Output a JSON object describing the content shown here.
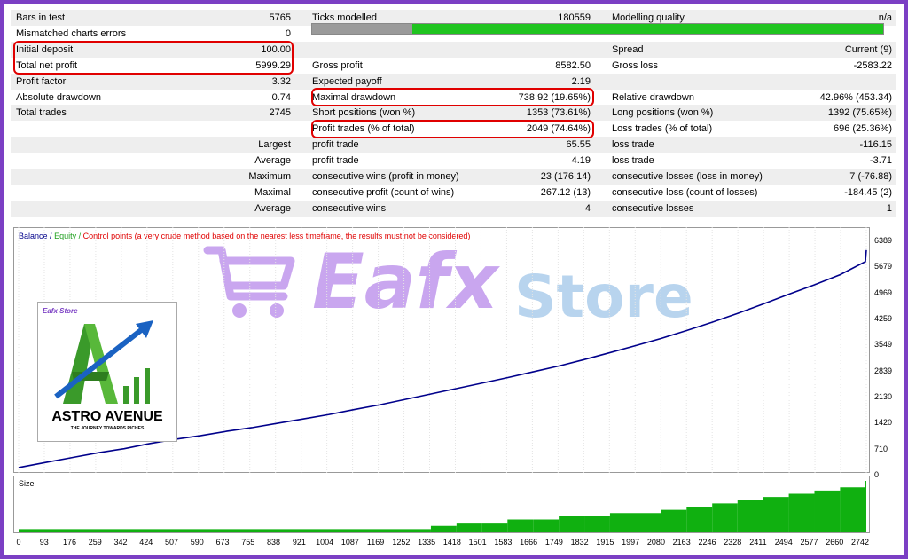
{
  "stats": {
    "rows": [
      {
        "c1l": "Bars in test",
        "c1v": "5765",
        "c2l": "Ticks modelled",
        "c2v": "180559",
        "c3l": "Modelling quality",
        "c3v": "n/a"
      },
      {
        "c1l": "Mismatched charts errors",
        "c1v": "0",
        "c2l": "",
        "c2v": "",
        "c3l": "",
        "c3v": ""
      },
      {
        "c1l": "Initial deposit",
        "c1v": "100.00",
        "c2l": "",
        "c2v": "",
        "c3l": "Spread",
        "c3v": "Current (9)"
      },
      {
        "c1l": "Total net profit",
        "c1v": "5999.29",
        "c2l": "Gross profit",
        "c2v": "8582.50",
        "c3l": "Gross loss",
        "c3v": "-2583.22"
      },
      {
        "c1l": "Profit factor",
        "c1v": "3.32",
        "c2l": "Expected payoff",
        "c2v": "2.19",
        "c3l": "",
        "c3v": ""
      },
      {
        "c1l": "Absolute drawdown",
        "c1v": "0.74",
        "c2l": "Maximal drawdown",
        "c2v": "738.92 (19.65%)",
        "c3l": "Relative drawdown",
        "c3v": "42.96% (453.34)"
      },
      {
        "c1l": "Total trades",
        "c1v": "2745",
        "c2l": "Short positions (won %)",
        "c2v": "1353 (73.61%)",
        "c3l": "Long positions (won %)",
        "c3v": "1392 (75.65%)"
      },
      {
        "c1l": "",
        "c1v": "",
        "c2l": "Profit trades (% of total)",
        "c2v": "2049 (74.64%)",
        "c3l": "Loss trades (% of total)",
        "c3v": "696 (25.36%)"
      },
      {
        "c1l": "",
        "c1v": "Largest",
        "c2l": "profit trade",
        "c2v": "65.55",
        "c3l": "loss trade",
        "c3v": "-116.15"
      },
      {
        "c1l": "",
        "c1v": "Average",
        "c2l": "profit trade",
        "c2v": "4.19",
        "c3l": "loss trade",
        "c3v": "-3.71"
      },
      {
        "c1l": "",
        "c1v": "Maximum",
        "c2l": "consecutive wins (profit in money)",
        "c2v": "23 (176.14)",
        "c3l": "consecutive losses (loss in money)",
        "c3v": "7 (-76.88)"
      },
      {
        "c1l": "",
        "c1v": "Maximal",
        "c2l": "consecutive profit (count of wins)",
        "c2v": "267.12 (13)",
        "c3l": "consecutive loss (count of losses)",
        "c3v": "-184.45 (2)"
      },
      {
        "c1l": "",
        "c1v": "Average",
        "c2l": "consecutive wins",
        "c2v": "4",
        "c3l": "consecutive losses",
        "c3v": "1"
      }
    ]
  },
  "quality_bar": {
    "gray_fraction": 0.175,
    "gray_color": "#9a9a9a",
    "green_color": "#1fc41f"
  },
  "legend": {
    "balance": "Balance",
    "equity": "Equity",
    "control": "Control points (a very crude method based on the nearest less timeframe, the results must not be considered)",
    "balance_color": "#00008b",
    "equity_color": "#1fa01f",
    "control_color": "#e00000",
    "sep": "/"
  },
  "size_label": "Size",
  "watermark": {
    "text1": "Eafx",
    "text2": "Store",
    "color1": "#c9a6ef",
    "color2": "#b8d4ee"
  },
  "logo": {
    "brand": "Eafx Store",
    "title": "ASTRO AVENUE",
    "tagline": "THE JOURNEY TOWARDS RICHES"
  },
  "chart_data": {
    "type": "line",
    "title": "",
    "xlabel": "",
    "ylabel": "",
    "y_ticks": [
      "6389",
      "5679",
      "4969",
      "4259",
      "3549",
      "2839",
      "2130",
      "1420",
      "710",
      "0"
    ],
    "x_ticks": [
      "0",
      "93",
      "176",
      "259",
      "342",
      "424",
      "507",
      "590",
      "673",
      "755",
      "838",
      "921",
      "1004",
      "1087",
      "1169",
      "1252",
      "1335",
      "1418",
      "1501",
      "1583",
      "1666",
      "1749",
      "1832",
      "1915",
      "1997",
      "2080",
      "2163",
      "2246",
      "2328",
      "2411",
      "2494",
      "2577",
      "2660",
      "2742"
    ],
    "xlim": [
      0,
      2745
    ],
    "ylim": [
      0,
      6389
    ],
    "series": [
      {
        "name": "Balance",
        "x": [
          0,
          93,
          176,
          259,
          342,
          424,
          507,
          590,
          673,
          755,
          838,
          921,
          1004,
          1087,
          1169,
          1252,
          1335,
          1418,
          1501,
          1583,
          1666,
          1749,
          1832,
          1915,
          1997,
          2080,
          2163,
          2246,
          2328,
          2411,
          2494,
          2577,
          2660,
          2742,
          2745
        ],
        "y": [
          100,
          250,
          380,
          510,
          620,
          760,
          880,
          980,
          1100,
          1200,
          1320,
          1440,
          1560,
          1700,
          1830,
          1980,
          2130,
          2280,
          2430,
          2580,
          2740,
          2900,
          3080,
          3270,
          3460,
          3660,
          3880,
          4110,
          4350,
          4610,
          4880,
          5140,
          5420,
          5780,
          6100
        ]
      }
    ],
    "size_series": {
      "x": [
        0,
        1335,
        1418,
        1501,
        1583,
        1666,
        1749,
        1832,
        1915,
        1997,
        2080,
        2163,
        2246,
        2328,
        2411,
        2494,
        2577,
        2660,
        2742
      ],
      "levels": [
        1,
        2,
        3,
        3,
        4,
        4,
        5,
        5,
        6,
        6,
        7,
        8,
        9,
        10,
        11,
        12,
        13,
        14,
        16
      ],
      "max_level": 16
    }
  }
}
